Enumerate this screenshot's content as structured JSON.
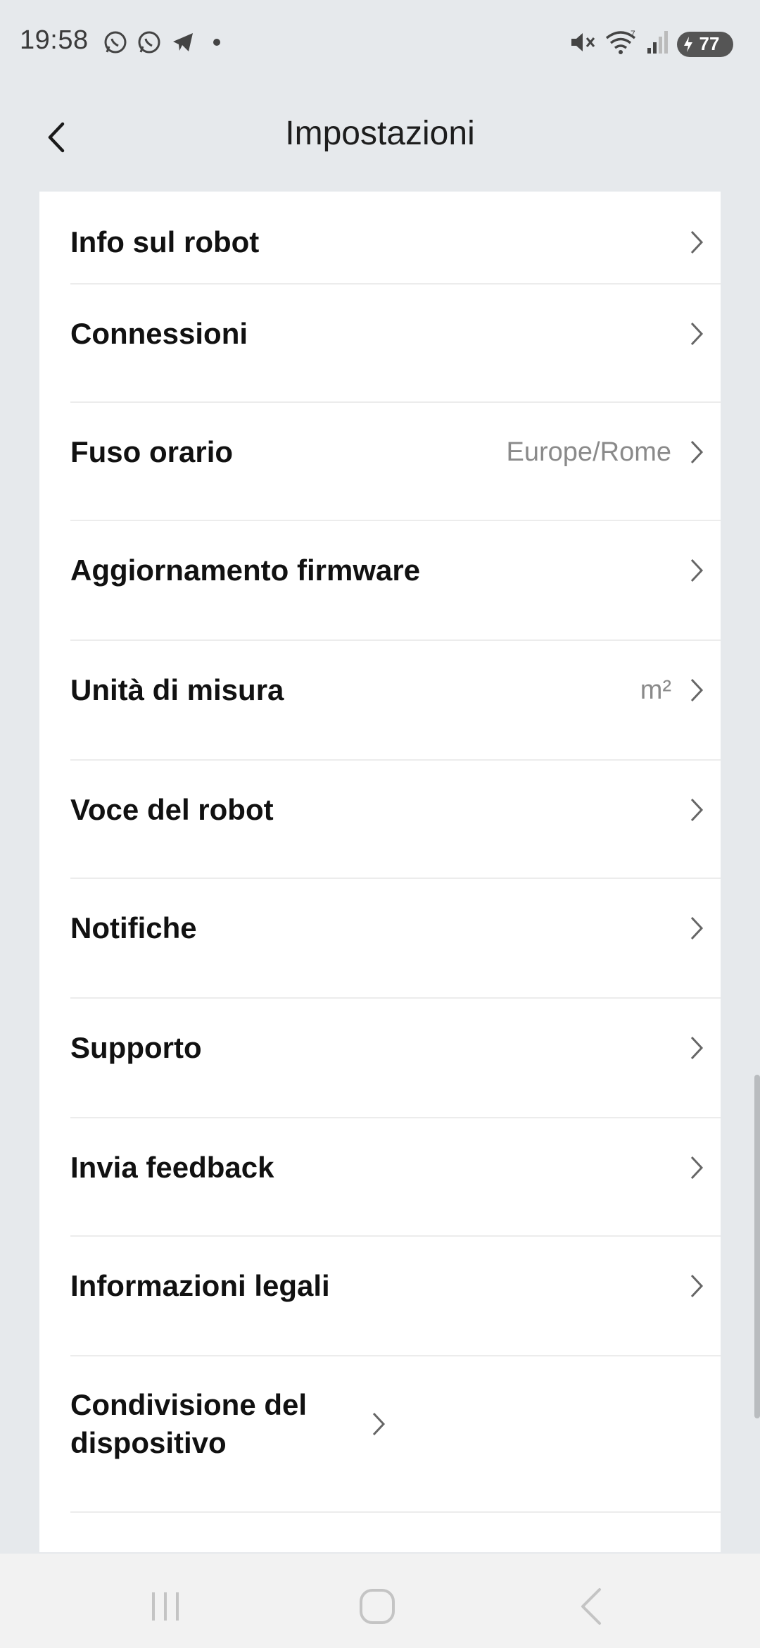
{
  "status_bar": {
    "time": "19:58",
    "battery": "77",
    "left_icons": [
      "whatsapp-icon",
      "whatsapp-icon",
      "telegram-icon",
      "dot-icon"
    ],
    "right_icons": [
      "mute-icon",
      "wifi-icon",
      "signal-icon",
      "battery-icon"
    ]
  },
  "header": {
    "title": "Impostazioni",
    "back_icon": "chevron-left-icon"
  },
  "settings": {
    "items": [
      {
        "label": "Info sul robot",
        "value": ""
      },
      {
        "label": "Connessioni",
        "value": ""
      },
      {
        "label": "Fuso orario",
        "value": "Europe/Rome"
      },
      {
        "label": "Aggiornamento firmware",
        "value": ""
      },
      {
        "label": "Unità di misura",
        "value": "m²"
      },
      {
        "label": "Voce del robot",
        "value": ""
      },
      {
        "label": "Notifiche",
        "value": ""
      },
      {
        "label": "Supporto",
        "value": ""
      },
      {
        "label": "Invia feedback",
        "value": ""
      },
      {
        "label": "Informazioni legali",
        "value": ""
      },
      {
        "label": "Condivisione del dispositivo",
        "value": ""
      }
    ]
  },
  "nav_bar": {
    "icons": [
      "recents-icon",
      "home-icon",
      "back-icon"
    ]
  },
  "colors": {
    "background": "#e6e9ec",
    "card": "#ffffff",
    "label": "#111111",
    "value": "#8a8a8a"
  }
}
